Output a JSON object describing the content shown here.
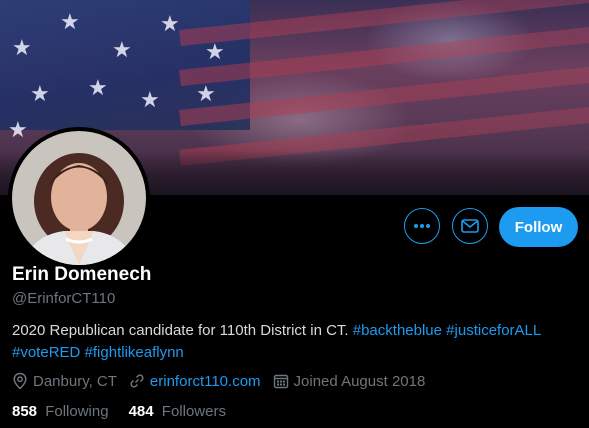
{
  "profile": {
    "name": "Erin Domenech",
    "handle": "@ErinforCT110",
    "bio_text": "2020 Republican candidate for 110th District in CT.",
    "bio_hashtags": [
      "#backtheblue",
      "#justiceforALL",
      "#voteRED",
      "#fightlikeaflynn"
    ],
    "location": "Danbury, CT",
    "website": "erinforct110.com",
    "joined": "Joined August 2018",
    "following_count": "858",
    "following_label": "Following",
    "followers_count": "484",
    "followers_label": "Followers"
  },
  "actions": {
    "more_icon": "more-dots-icon",
    "message_icon": "envelope-icon",
    "follow_label": "Follow"
  },
  "icons": {
    "location": "location-pin-icon",
    "link": "link-icon",
    "calendar": "calendar-icon"
  },
  "colors": {
    "accent": "#1d9bf0",
    "background": "#000000",
    "secondary_text": "#6e767d"
  }
}
